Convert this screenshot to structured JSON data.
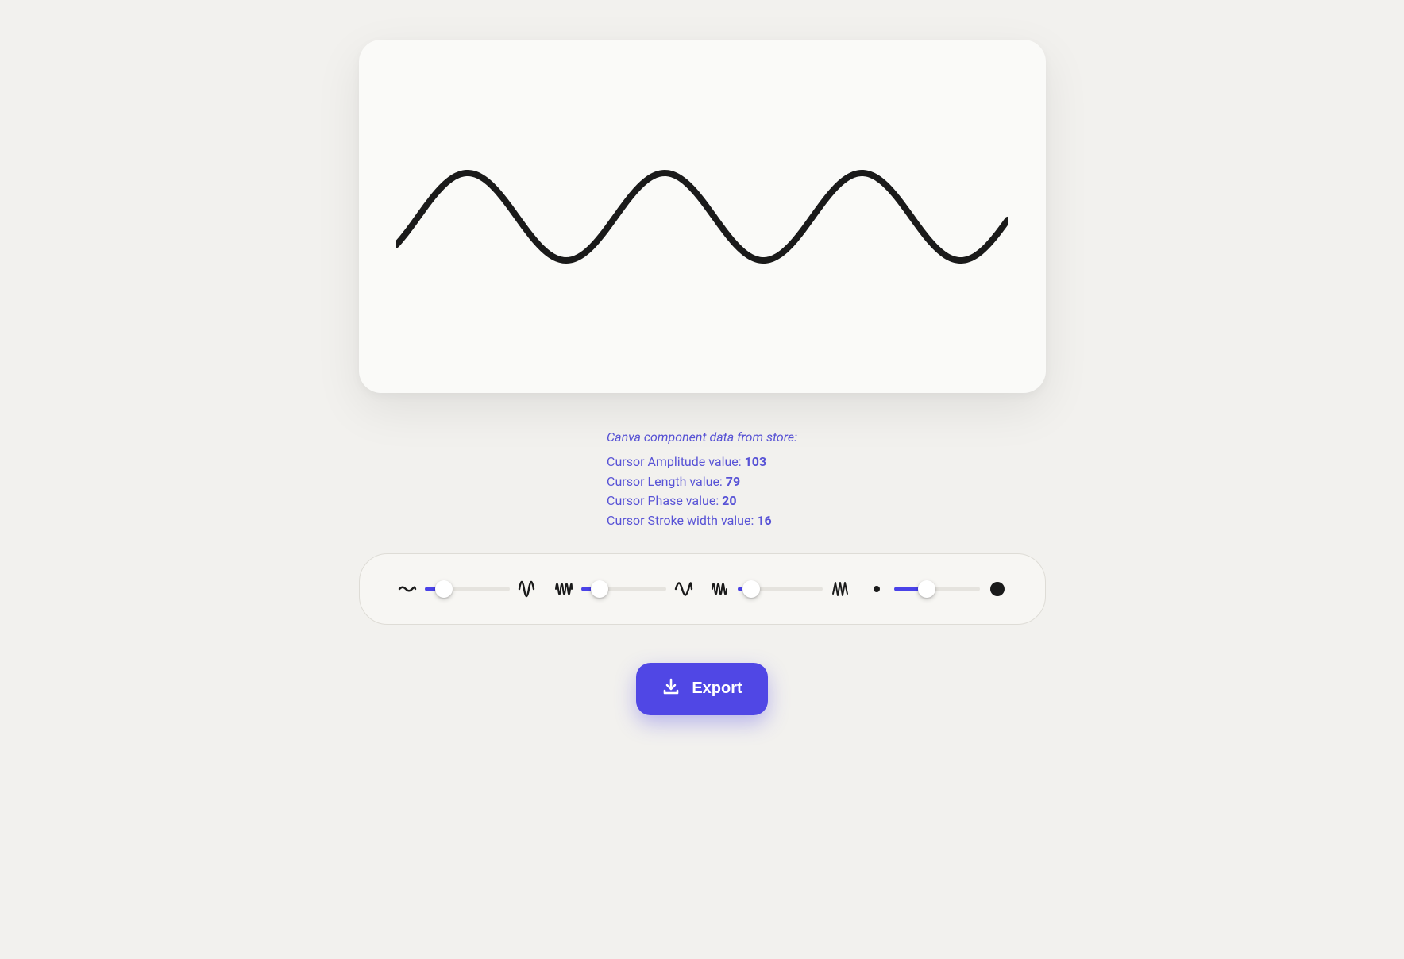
{
  "canvas": {
    "wave_color": "#1a1a1a",
    "wave_stroke_width": 8
  },
  "store": {
    "title": "Canva component data from store:",
    "rows": [
      {
        "label": "Cursor Amplitude value: ",
        "value": "103"
      },
      {
        "label": "Cursor Length value: ",
        "value": "79"
      },
      {
        "label": "Cursor Phase value: ",
        "value": "20"
      },
      {
        "label": "Cursor Stroke width value: ",
        "value": "16"
      }
    ]
  },
  "sliders": {
    "amplitude_pct": 23,
    "length_pct": 22,
    "phase_pct": 16,
    "stroke_pct": 38
  },
  "export": {
    "label": "Export"
  },
  "colors": {
    "accent": "#5047e5",
    "text_accent": "#5853d6"
  }
}
